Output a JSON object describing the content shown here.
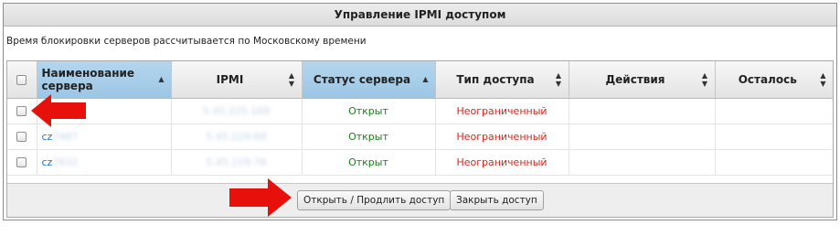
{
  "panel": {
    "title": "Управление IPMI доступом",
    "note": "Время блокировки серверов рассчитывается по Московскому времени"
  },
  "table": {
    "columns": [
      {
        "label": "",
        "sort": ""
      },
      {
        "label": "Наименование сервера",
        "sort": "▲"
      },
      {
        "label": "IPMI",
        "sort": "▲▼"
      },
      {
        "label": "Статус сервера",
        "sort": "▲"
      },
      {
        "label": "Тип доступа",
        "sort": "▲▼"
      },
      {
        "label": "Действия",
        "sort": "▲▼"
      },
      {
        "label": "Осталось",
        "sort": "▲▼"
      }
    ],
    "rows": [
      {
        "name_prefix": "",
        "name_rest": "",
        "ipmi": "5.45.225.169",
        "status": "Открыт",
        "access": "Неограниченный",
        "actions": "",
        "remaining": ""
      },
      {
        "name_prefix": "cz",
        "name_rest": "7487",
        "ipmi": "5.45.229.68",
        "status": "Открыт",
        "access": "Неограниченный",
        "actions": "",
        "remaining": ""
      },
      {
        "name_prefix": "cz",
        "name_rest": "7832",
        "ipmi": "5.45.229.76",
        "status": "Открыт",
        "access": "Неограниченный",
        "actions": "",
        "remaining": ""
      }
    ]
  },
  "buttons": {
    "open_extend": "Открыть / Продлить доступ",
    "close": "Закрыть доступ"
  },
  "colors": {
    "status_open": "#1f7a1f",
    "access_type": "#d9261c",
    "sorted_header": "#9cc6e4",
    "arrow": "#e8100a"
  }
}
